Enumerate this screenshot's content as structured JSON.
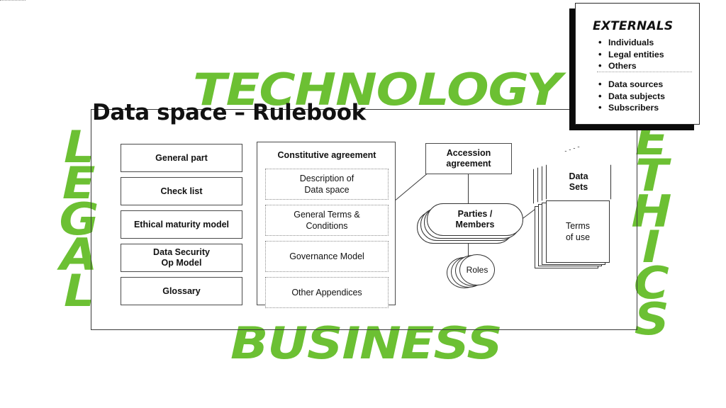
{
  "title": "Data space – Rulebook",
  "colors": {
    "accent_green": "#6CC033",
    "line": "#3a3a3a",
    "text": "#111111"
  },
  "pillars": {
    "top": "TECHNOLOGY",
    "bottom": "BUSINESS",
    "left": "LEGAL",
    "right": "ETHICS",
    "left_letters": [
      "L",
      "E",
      "G",
      "A",
      "L"
    ],
    "right_letters": [
      "E",
      "T",
      "H",
      "I",
      "C",
      "S"
    ]
  },
  "left_column": {
    "items": [
      {
        "label": "General part"
      },
      {
        "label": "Check list"
      },
      {
        "label": "Ethical maturity model"
      },
      {
        "label": "Data Security\nOp Model"
      },
      {
        "label": "Glossary"
      }
    ]
  },
  "constitutive": {
    "title": "Constitutive agreement",
    "items": [
      {
        "label": "Description of\nData space"
      },
      {
        "label": "General Terms &\nConditions"
      },
      {
        "label": "Governance Model"
      },
      {
        "label": "Other Appendices"
      }
    ]
  },
  "right_side": {
    "accession": "Accession\nagreement",
    "parties": "Parties /\nMembers",
    "roles": "Roles",
    "data_sets": "Data\nSets",
    "terms_of_use": "Terms\nof use"
  },
  "externals": {
    "title": "EXTERNALS",
    "group_a": [
      "Individuals",
      "Legal entities",
      "Others"
    ],
    "group_b": [
      "Data sources",
      "Data subjects",
      "Subscribers"
    ]
  }
}
